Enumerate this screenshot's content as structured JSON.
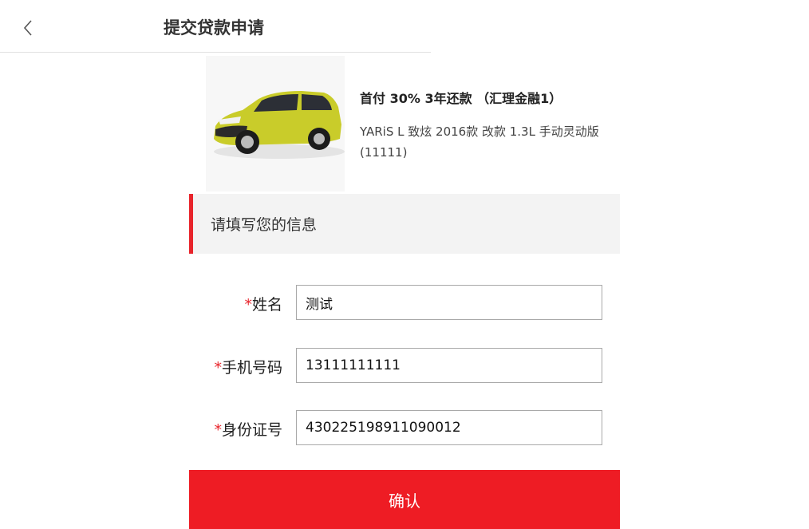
{
  "header": {
    "title": "提交贷款申请",
    "back_icon": "chevron-left-icon"
  },
  "product": {
    "plan": "首付 30% 3年还款 （汇理金融1）",
    "model": "YARiS L 致炫 2016款 改款 1.3L 手动灵动版(11111)",
    "car_color": "#c9cc2a"
  },
  "section": {
    "title": "请填写您的信息",
    "accent_color": "#e8242b"
  },
  "form": {
    "required_mark": "*",
    "name_label": "姓名",
    "name_value": "测试",
    "phone_label": "手机号码",
    "phone_value": "13111111111",
    "id_label": "身份证号",
    "id_value": "430225198911090012"
  },
  "actions": {
    "confirm_label": "确认",
    "confirm_color": "#ee1c24"
  }
}
